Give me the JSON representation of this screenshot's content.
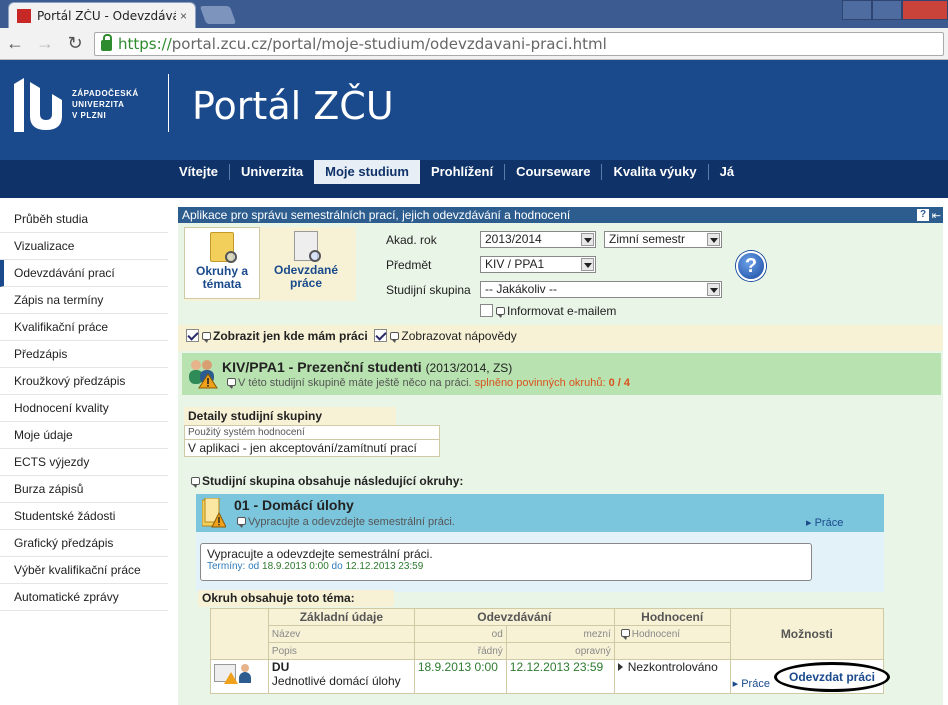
{
  "browser": {
    "tab_title": "Portál ZČU - Odevzdávání",
    "tab_close": "×",
    "url_scheme": "https://",
    "url_rest": "portal.zcu.cz/portal/moje-studium/odevzdavani-praci.html"
  },
  "header": {
    "logo_line1": "ZÁPADOČESKÁ",
    "logo_line2": "UNIVERZITA",
    "logo_line3": "V PLZNI",
    "title": "Portál ZČU"
  },
  "topnav": [
    "Vítejte",
    "Univerzita",
    "Moje studium",
    "Prohlížení",
    "Courseware",
    "Kvalita výuky",
    "Já"
  ],
  "sidebar": [
    "Průběh studia",
    "Vizualizace",
    "Odevzdávání prací",
    "Zápis na termíny",
    "Kvalifikační práce",
    "Předzápis",
    "Kroužkový předzápis",
    "Hodnocení kvality",
    "Moje údaje",
    "ECTS výjezdy",
    "Burza zápisů",
    "Studentské žádosti",
    "Grafický předzápis",
    "Výběr kvalifikační práce",
    "Automatické zprávy"
  ],
  "app": {
    "title": "Aplikace pro správu semestrálních prací, jejich odevzdávání a hodnocení",
    "help_mini": "?",
    "arrow_mini": "⇤",
    "mode1_line1": "Okruhy a",
    "mode1_line2": "témata",
    "mode2_line1": "Odevzdané",
    "mode2_line2": "práce",
    "label_year": "Akad. rok",
    "year": "2013/2014",
    "semester": "Zimní semestr",
    "label_subject": "Předmět",
    "subject": "KIV / PPA1",
    "label_group": "Studijní skupina",
    "group_value": "-- Jakákoliv --",
    "notify": "Informovat e-mailem",
    "help_big": "?",
    "opt_only_mine": "Zobrazit jen kde mám práci",
    "opt_hints": "Zobrazovat nápovědy"
  },
  "group": {
    "title": "KIV/PPA1 - Prezenční studenti",
    "meta": "(2013/2014, ZS)",
    "hint": "V této studijní skupině máte ještě něco na práci.",
    "progress_label": "splněno povinných okruhů:",
    "progress": "0 / 4"
  },
  "details": {
    "head": "Detaily studijní skupiny",
    "label": "Použitý systém hodnocení",
    "value": "V aplikaci - jen akceptování/zamítnutí prací"
  },
  "topics_head": "Studijní skupina obsahuje následující okruhy:",
  "topic": {
    "title": "01 - Domácí úlohy",
    "sub": "Vypracujte a odevzdejte semestrální práci.",
    "link": "Práce",
    "desc": "Vypracujte a odevzdejte semestrální práci.",
    "terms_label": "Termíny:",
    "from_label": "od",
    "from": "18.9.2013 0:00",
    "to_label": "do",
    "to": "12.12.2013 23:59"
  },
  "theme_head": "Okruh obsahuje toto téma:",
  "table": {
    "h_basic": "Základní údaje",
    "h_submit": "Odevzdávání",
    "h_eval": "Hodnocení",
    "h_options": "Možnosti",
    "h_name": "Název",
    "h_from": "od",
    "h_deadline": "mezní",
    "h_eval_sub": "Hodnocení",
    "h_desc": "Popis",
    "h_regular": "řádný",
    "h_corrective": "opravný",
    "row_name": "DU",
    "row_desc": "Jednotlivé domácí úlohy",
    "row_from": "18.9.2013 0:00",
    "row_deadline": "12.12.2013 23:59",
    "row_status": "Nezkontrolováno",
    "row_link": "Práce"
  },
  "submit_button": "Odevzdat práci"
}
